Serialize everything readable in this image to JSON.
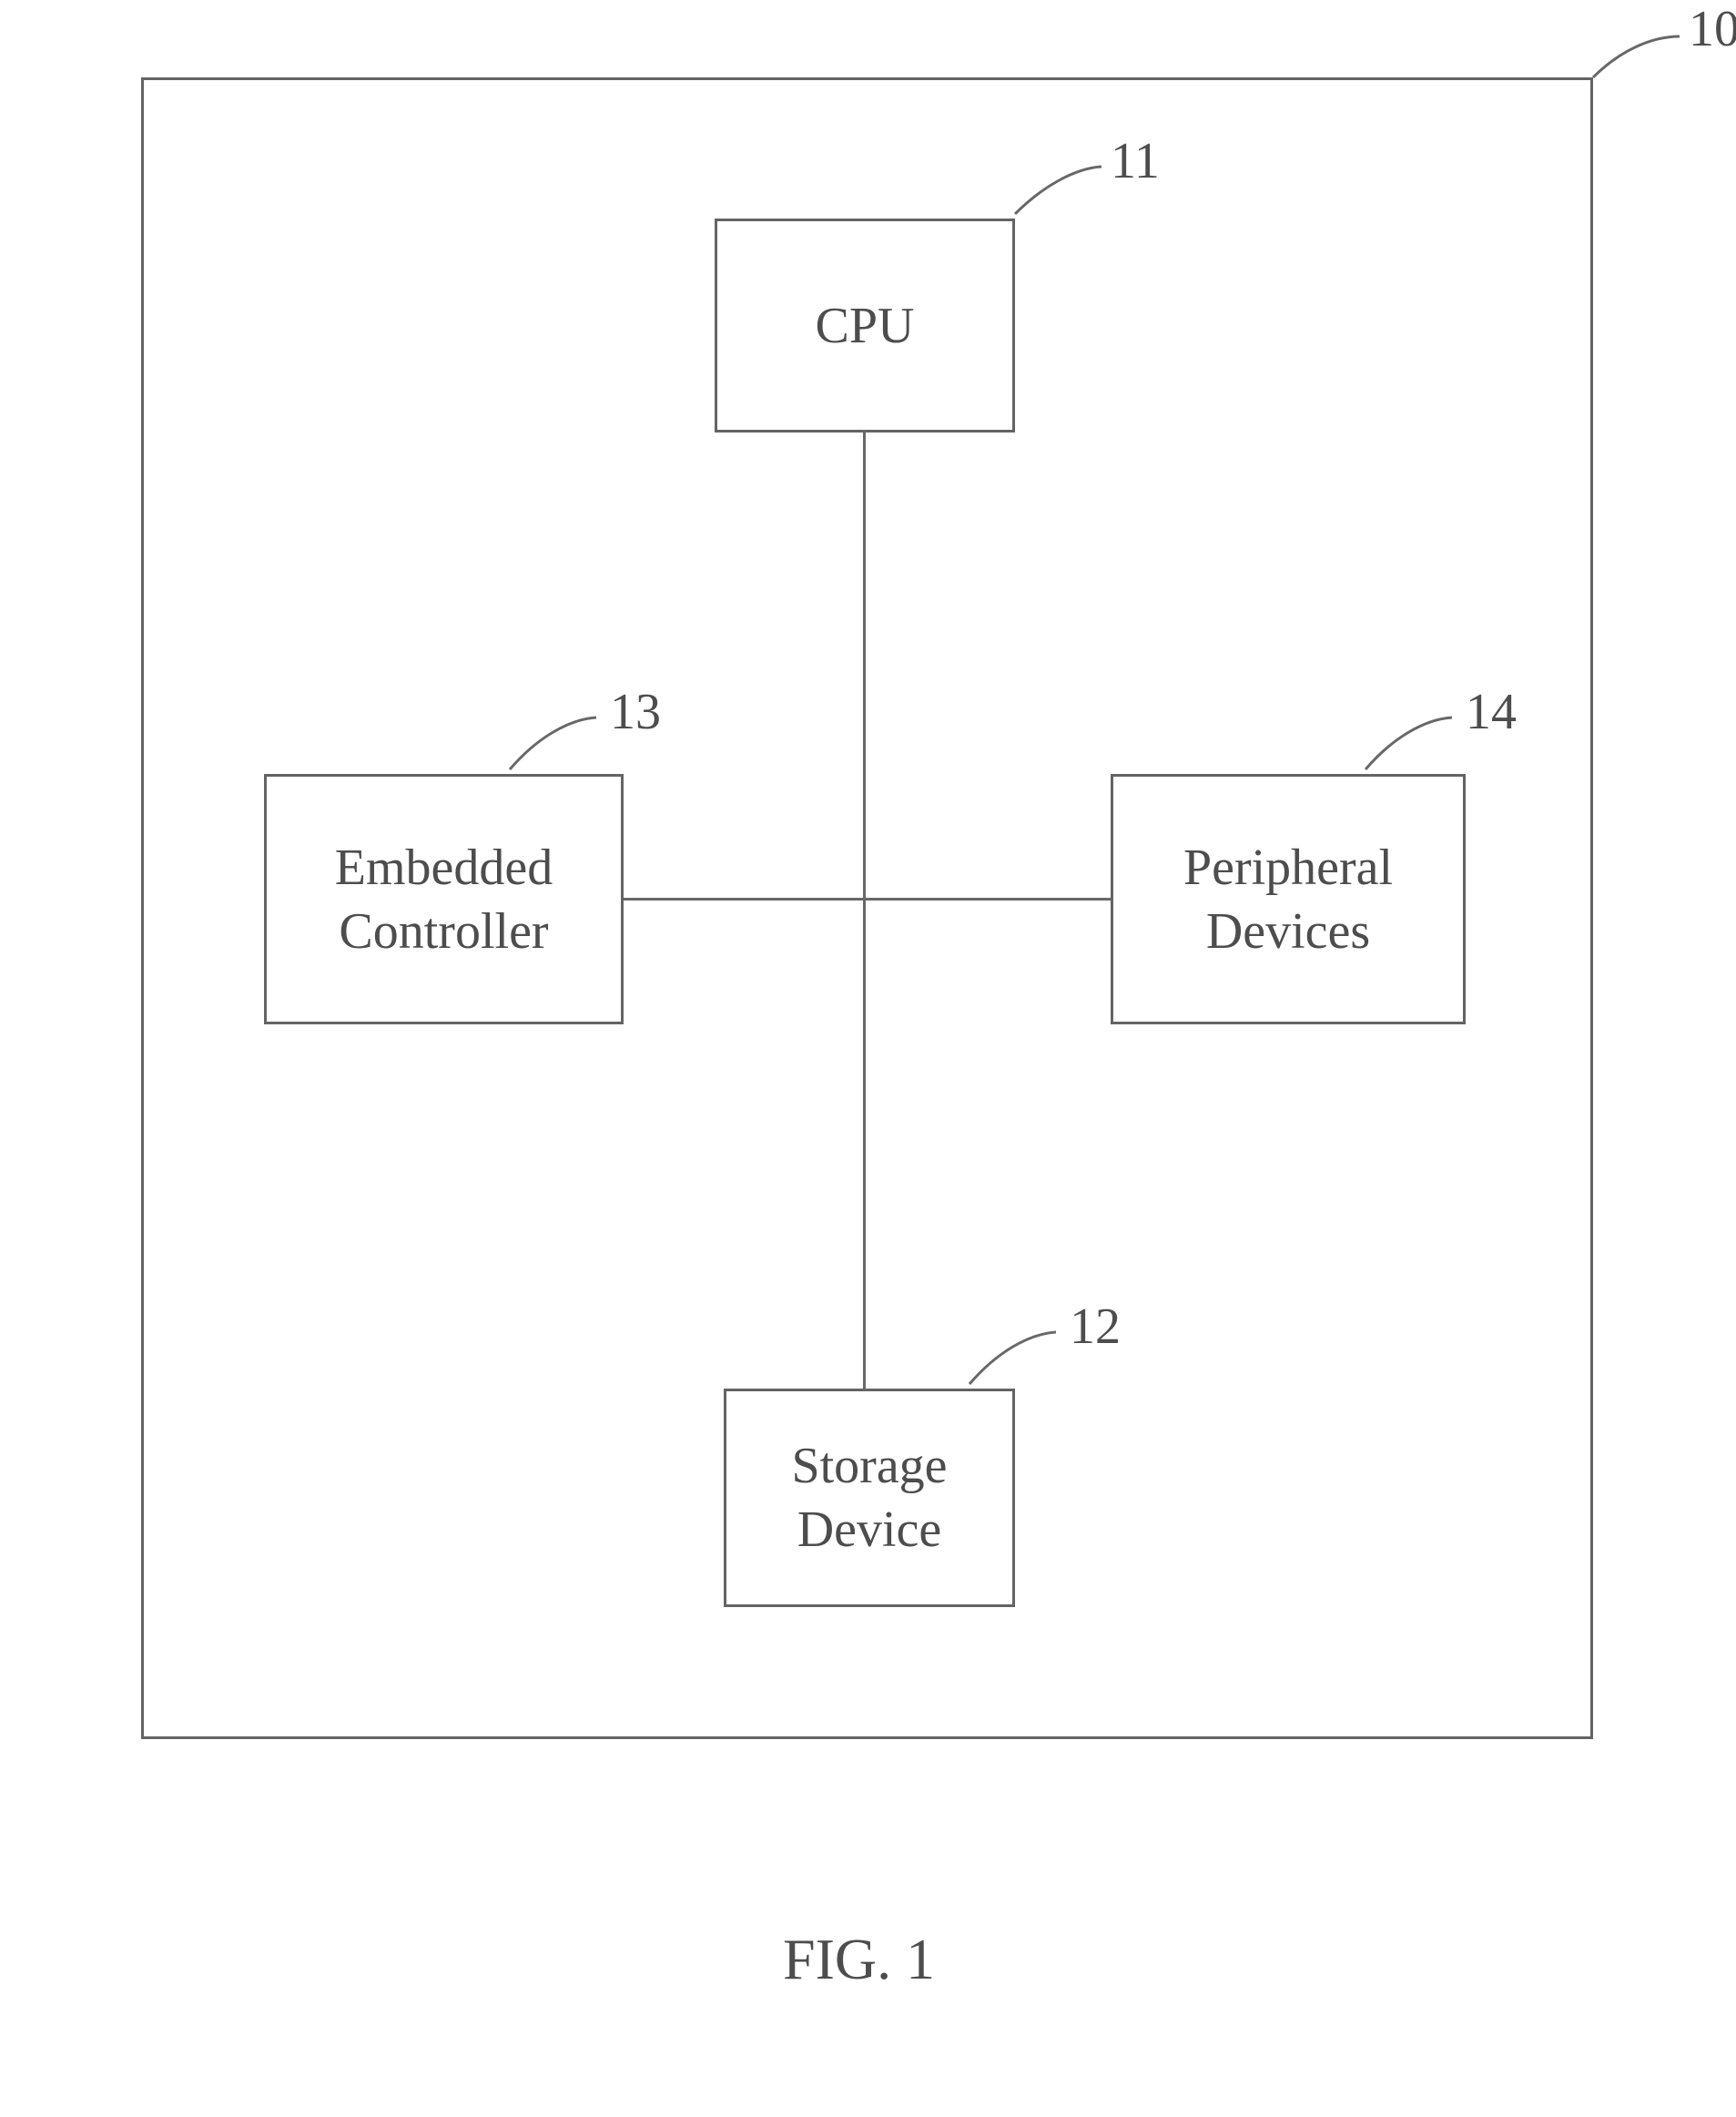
{
  "figure_label": "FIG. 1",
  "outer": {
    "ref": "10"
  },
  "blocks": {
    "cpu": {
      "label": "CPU",
      "ref": "11"
    },
    "storage": {
      "label": "Storage\nDevice",
      "ref": "12"
    },
    "controller": {
      "label": "Embedded\nController",
      "ref": "13"
    },
    "peripheral": {
      "label": "Peripheral\nDevices",
      "ref": "14"
    }
  }
}
